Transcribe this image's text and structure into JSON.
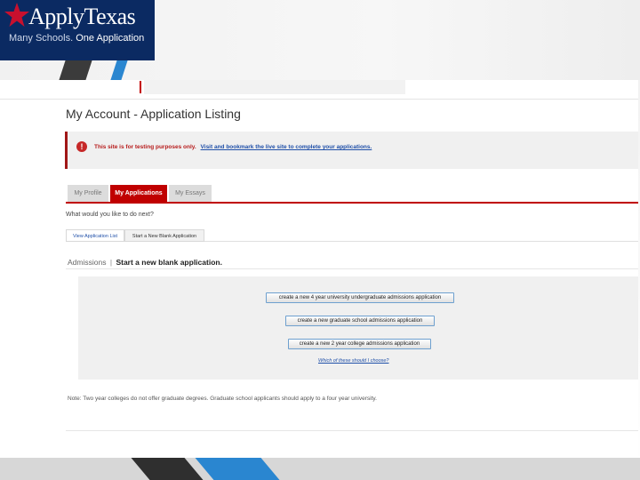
{
  "logo": {
    "brand": "ApplyTexas",
    "tagline_left": "Many Schools.",
    "tagline_right": "One Application",
    "colors": {
      "background": "#0b2a62",
      "star": "#c8102e"
    }
  },
  "page": {
    "title": "My Account - Application Listing"
  },
  "alert": {
    "icon": "!",
    "message": "This site is for testing purposes only.",
    "link_text": "Visit and bookmark the live site to complete your applications."
  },
  "tabs": [
    {
      "label": "My Profile"
    },
    {
      "label": "My Applications"
    },
    {
      "label": "My Essays"
    }
  ],
  "question": "What would you like to do next?",
  "subtabs": [
    {
      "label": "View Application List"
    },
    {
      "label": "Start a New Blank Application"
    }
  ],
  "section": {
    "crumb": "Admissions",
    "separator": "|",
    "title": "Start a new blank application."
  },
  "buttons": [
    {
      "label": "create a new 4 year university undergraduate admissions application"
    },
    {
      "label": "create a new graduate school admissions application"
    },
    {
      "label": "create a new 2 year college admissions application"
    }
  ],
  "help_link": "Which of these should I choose?",
  "note": "Note: Two year colleges do not offer graduate degrees. Graduate school applicants should apply to a four year university.",
  "colors": {
    "accent_red": "#c00000",
    "link_blue": "#1f4fa8",
    "slide_blue": "#2a86d0"
  }
}
